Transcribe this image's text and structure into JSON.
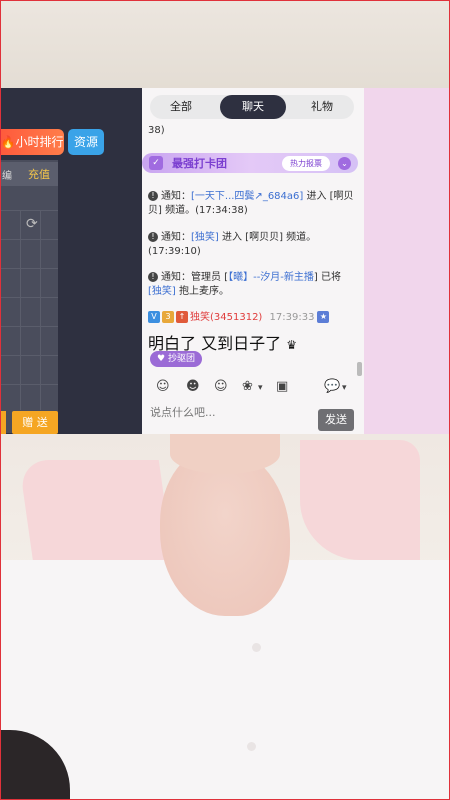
{
  "left_panel": {
    "rank_button": "小时排行",
    "resource_button": "资源",
    "header_left": "编",
    "header_right": "充值",
    "gift_button": "赠 送"
  },
  "chat": {
    "tabs": [
      "全部",
      "聊天",
      "礼物"
    ],
    "active_tab": "聊天",
    "partial_top": "38)",
    "card_banner": {
      "title": "最强打卡团",
      "hot_button": "热力报票"
    },
    "messages": [
      {
        "prefix": "通知：",
        "user": "[一天下...四鬓↗_684a6]",
        "text": " 进入 [啊贝贝] 频道。(17:34:38)"
      },
      {
        "prefix": "通知：",
        "user": "[独笑]",
        "text": " 进入 [啊贝贝] 频道。(17:39:10)"
      },
      {
        "prefix": "通知：",
        "pre_text": "管理员 [",
        "user": "【曦】--汐月-新主播",
        "mid_text": "] 已将 ",
        "user2": "[独笑]",
        "text": " 抱上麦序。"
      }
    ],
    "user_message": {
      "username": "独笑(3451312)",
      "time": "17:39:33",
      "content": "明白了 又到日子了",
      "fan_badge": "抄驱团"
    },
    "input_placeholder": "说点什么吧...",
    "send_button": "发送"
  },
  "colors": {
    "dark_panel": "#2e3040",
    "pink_panel": "#f1d6ec",
    "accent_purple": "#9b6bd6",
    "send_gray": "#6f6f73",
    "rank_orange": "#ff5a3c",
    "resource_blue": "#3aa3e8",
    "gift_yellow": "#f5a623"
  }
}
